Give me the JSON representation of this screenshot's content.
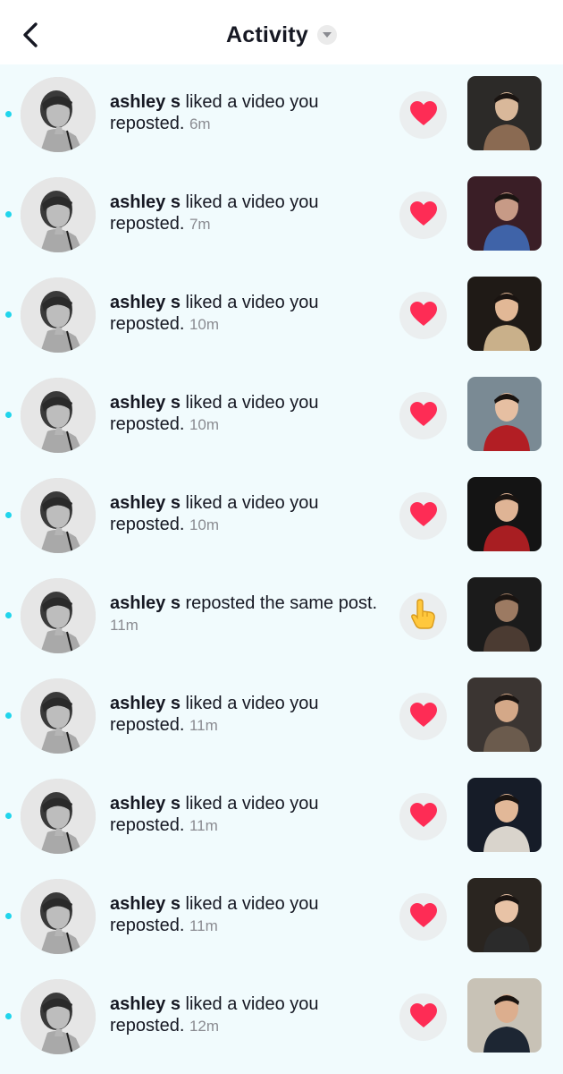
{
  "header": {
    "title": "Activity"
  },
  "notifications": [
    {
      "user": "ashley s",
      "action": " liked a video you reposted.",
      "time": "6m",
      "reaction": "heart-icon"
    },
    {
      "user": "ashley s",
      "action": " liked a video you reposted.",
      "time": "7m",
      "reaction": "heart-icon"
    },
    {
      "user": "ashley s",
      "action": " liked a video you reposted.",
      "time": "10m",
      "reaction": "heart-icon"
    },
    {
      "user": "ashley s",
      "action": " liked a video you reposted.",
      "time": "10m",
      "reaction": "heart-icon"
    },
    {
      "user": "ashley s",
      "action": " liked a video you reposted.",
      "time": "10m",
      "reaction": "heart-icon"
    },
    {
      "user": "ashley s",
      "action": " reposted the same post.",
      "time": "11m",
      "reaction": "pointing-hand-icon"
    },
    {
      "user": "ashley s",
      "action": " liked a video you reposted.",
      "time": "11m",
      "reaction": "heart-icon"
    },
    {
      "user": "ashley s",
      "action": " liked a video you reposted.",
      "time": "11m",
      "reaction": "heart-icon"
    },
    {
      "user": "ashley s",
      "action": " liked a video you reposted.",
      "time": "11m",
      "reaction": "heart-icon"
    },
    {
      "user": "ashley s",
      "action": " liked a video you reposted.",
      "time": "12m",
      "reaction": "heart-icon"
    }
  ],
  "colors": {
    "unread_dot": "#20d5ec",
    "list_background": "#f1fbfd",
    "heart": "#fe2c55",
    "time_text": "#8a8b91"
  }
}
